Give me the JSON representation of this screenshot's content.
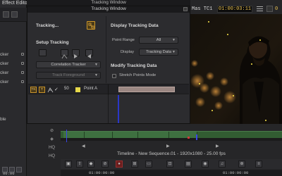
{
  "effect_editor": {
    "title": "Effect Editor",
    "items": [
      "cker",
      "cker",
      "cker",
      "cker"
    ],
    "bottom_label": "ble"
  },
  "top_strip": {
    "title": "Tracking Window"
  },
  "tracking_window": {
    "title": "Tracking Window",
    "tracking_label": "Tracking...",
    "setup_tracking": "Setup Tracking",
    "tracker_engine": "Correlation Tracker",
    "track_foreground": "Track Foreground",
    "display_tracking_data": "Display Tracking Data",
    "point_range_label": "Point Range",
    "point_range_value": "All",
    "display_label": "Display",
    "display_value": "Tracking Data",
    "modify_tracking_data": "Modify Tracking Data",
    "stretch_points_mode": "Stretch Points Mode",
    "tracker_row": {
      "button_1": "TK",
      "button_2": "T",
      "number": "50",
      "point_name": "Point A"
    }
  },
  "viewer": {
    "tc_label": "Mas TC1",
    "timecode": "01:00:03:11",
    "tc_right": "0"
  },
  "timeline": {
    "sequence_title": "Timeline - New Sequence.01 - 1920x1080 - 25.00 fps",
    "tc_left": "00:00",
    "tc_mid": "01:00:00:00",
    "tc_right": "01:00:00:00",
    "track_label_1": "HQ",
    "track_label_2": "HQ"
  },
  "colors": {
    "accent_orange": "#d19a2a",
    "timecode_yellow": "#e9c050",
    "point_yellow": "#e6d84a",
    "playhead_blue": "#2a36c8"
  }
}
